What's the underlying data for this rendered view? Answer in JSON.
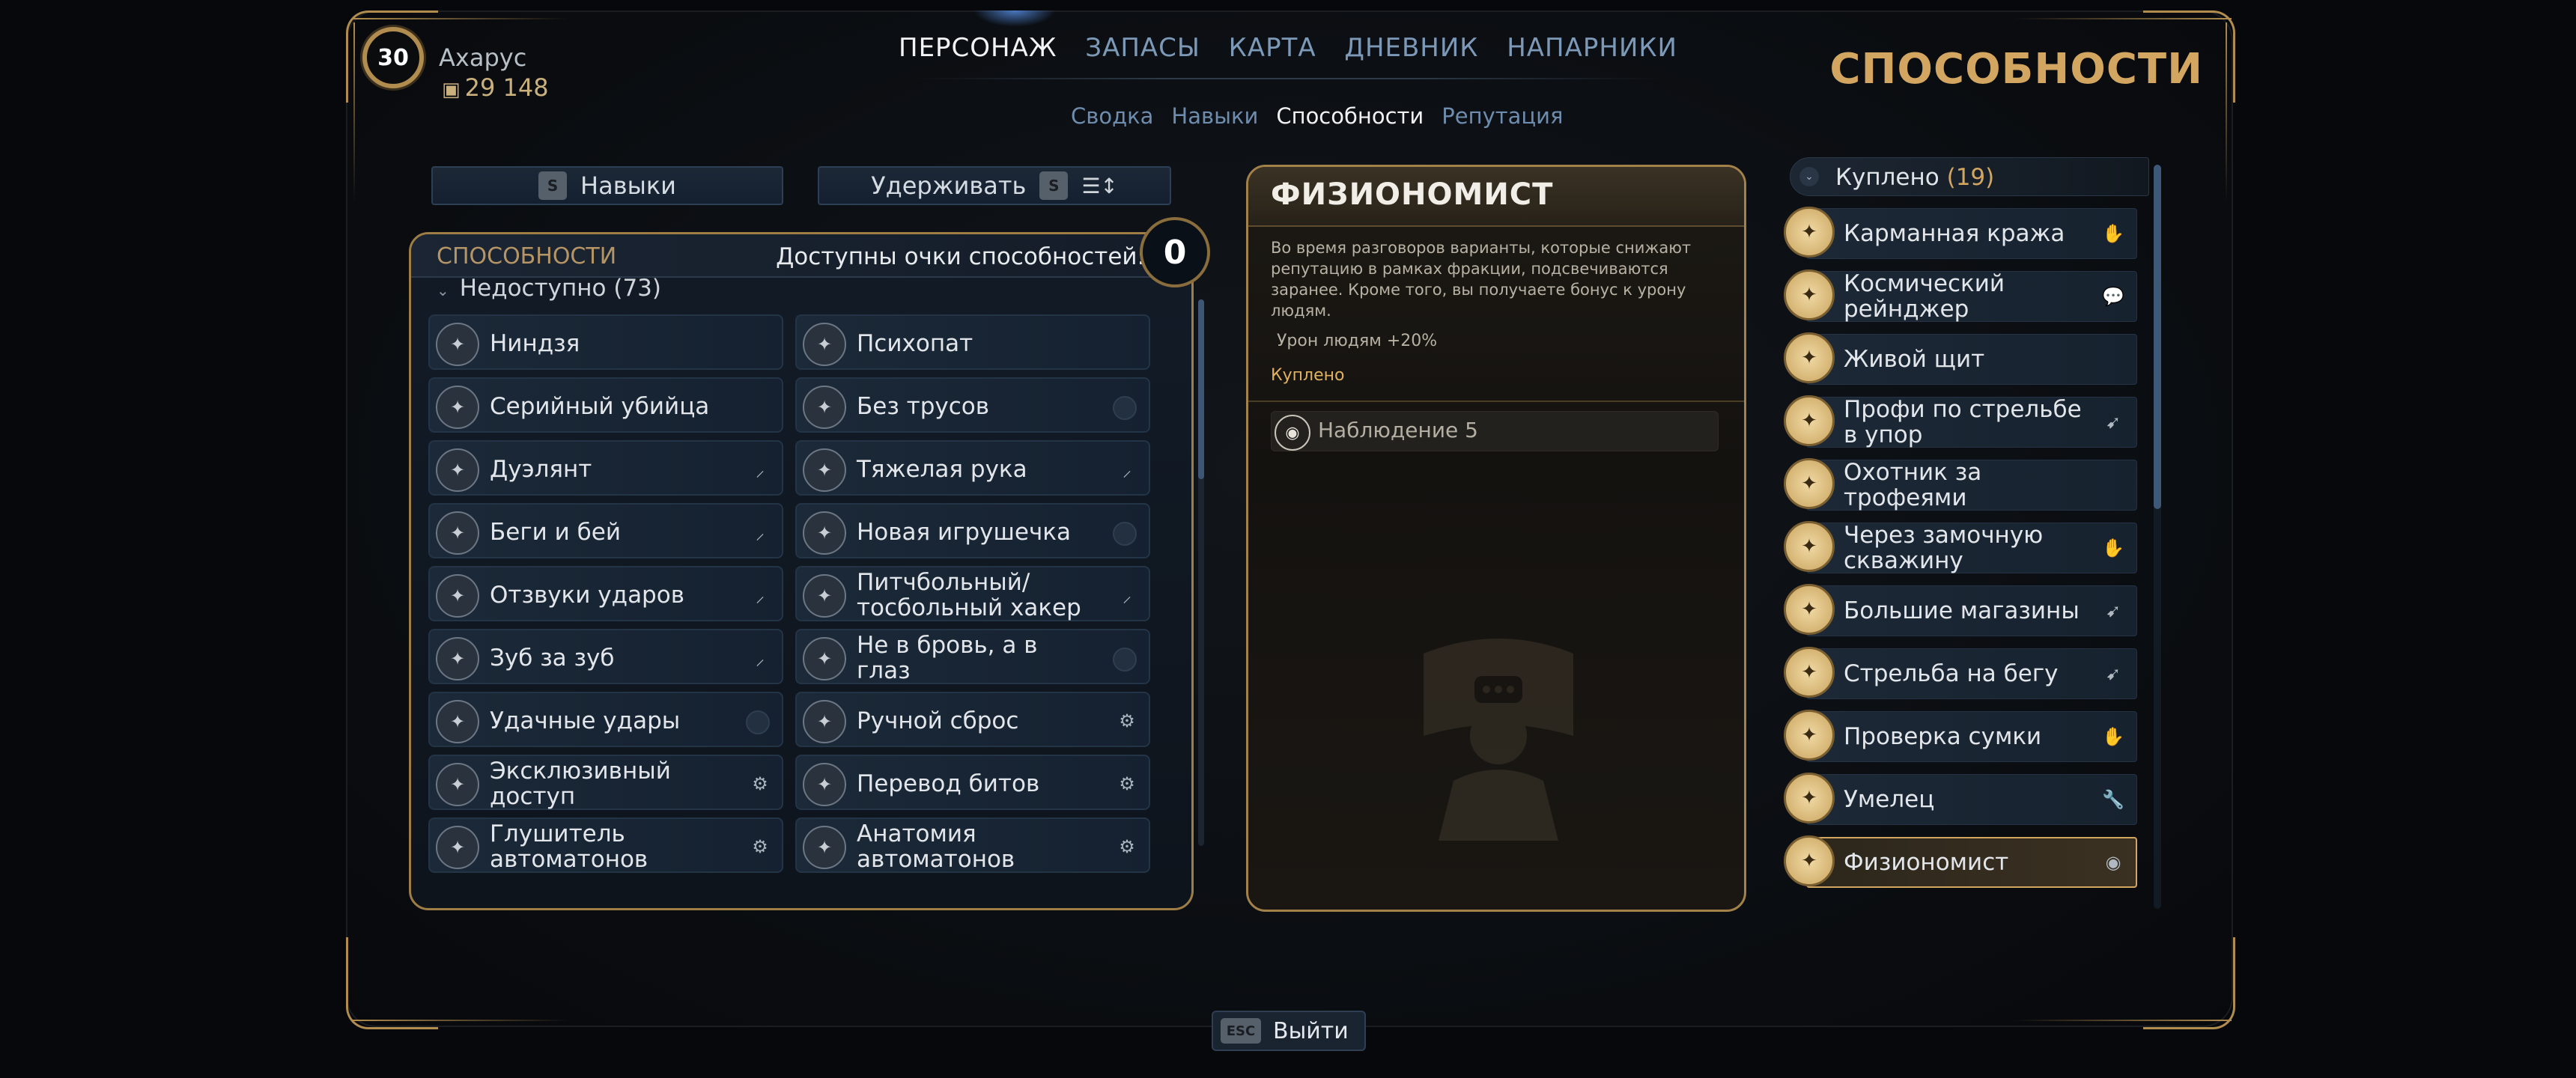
{
  "player": {
    "level": "30",
    "name": "Ахарус",
    "credits": "29 148",
    "credits_icon": "credits-icon"
  },
  "nav": {
    "tabs": [
      "ПЕРСОНАЖ",
      "ЗАПАСЫ",
      "КАРТА",
      "ДНЕВНИК",
      "НАПАРНИКИ"
    ],
    "active_tab": "ПЕРСОНАЖ",
    "subtabs": [
      "Сводка",
      "Навыки",
      "Способности",
      "Репутация"
    ],
    "active_subtab": "Способности"
  },
  "page_title": "СПОСОБНОСТИ",
  "controls": {
    "skills_key": "S",
    "skills_label": "Навыки",
    "hold_label": "Удерживать",
    "hold_key": "S",
    "sort_icon": "sort-icon"
  },
  "abilities": {
    "title": "СПОСОБНОСТИ",
    "points_label": "Доступны очки способностей:",
    "points_value": "0",
    "filter_label": "Недоступно (73)",
    "items": [
      {
        "label": "Ниндзя",
        "tag": ""
      },
      {
        "label": "Психопат",
        "tag": ""
      },
      {
        "label": "Серийный убийца",
        "tag": ""
      },
      {
        "label": "Без трусов",
        "tag": "dot"
      },
      {
        "label": "Дуэлянт",
        "tag": "melee"
      },
      {
        "label": "Тяжелая рука",
        "tag": "melee"
      },
      {
        "label": "Беги и бей",
        "tag": "melee"
      },
      {
        "label": "Новая игрушечка",
        "tag": "dot"
      },
      {
        "label": "Отзвуки ударов",
        "tag": "melee"
      },
      {
        "label": "Питчбольный/ тосбольный хакер",
        "tag": "melee"
      },
      {
        "label": "Зуб за зуб",
        "tag": "melee"
      },
      {
        "label": "Не в бровь, а в глаз",
        "tag": "dot"
      },
      {
        "label": "Удачные удары",
        "tag": "dot"
      },
      {
        "label": "Ручной сброс",
        "tag": "robot"
      },
      {
        "label": "Эксклюзивный доступ",
        "tag": "robot"
      },
      {
        "label": "Перевод битов",
        "tag": "robot"
      },
      {
        "label": "Глушитель автоматонов",
        "tag": "robot"
      },
      {
        "label": "Анатомия автоматонов",
        "tag": "robot"
      }
    ]
  },
  "detail": {
    "title": "ФИЗИОНОМИСТ",
    "description": "Во время разговоров варианты, которые снижают репутацию в рамках фракции, подсвечиваются заранее. Кроме того, вы получаете бонус к урону людям.",
    "bonus": "Урон людям +20%",
    "status": "Куплено",
    "requirement": "Наблюдение 5",
    "requirement_icon": "observation-icon"
  },
  "purchased": {
    "label": "Куплено",
    "count": "(19)",
    "items": [
      {
        "label": "Карманная кража",
        "tag": "hand"
      },
      {
        "label": "Космический рейнджер",
        "tag": "dialog"
      },
      {
        "label": "Живой щит",
        "tag": ""
      },
      {
        "label": "Профи по стрельбе в упор",
        "tag": "gun"
      },
      {
        "label": "Охотник за трофеями",
        "tag": ""
      },
      {
        "label": "Через замочную скважину",
        "tag": "hand"
      },
      {
        "label": "Большие магазины",
        "tag": "gun"
      },
      {
        "label": "Стрельба на бегу",
        "tag": "gun"
      },
      {
        "label": "Проверка сумки",
        "tag": "hand"
      },
      {
        "label": "Умелец",
        "tag": "wrench"
      },
      {
        "label": "Физиономист",
        "tag": "observe"
      }
    ],
    "selected": "Физиономист"
  },
  "footer": {
    "exit_key": "ESC",
    "exit_label": "Выйти"
  },
  "colors": {
    "accent_gold": "#d2a660",
    "nav_blue": "#7d99b8",
    "panel_bg": "#121b27"
  }
}
